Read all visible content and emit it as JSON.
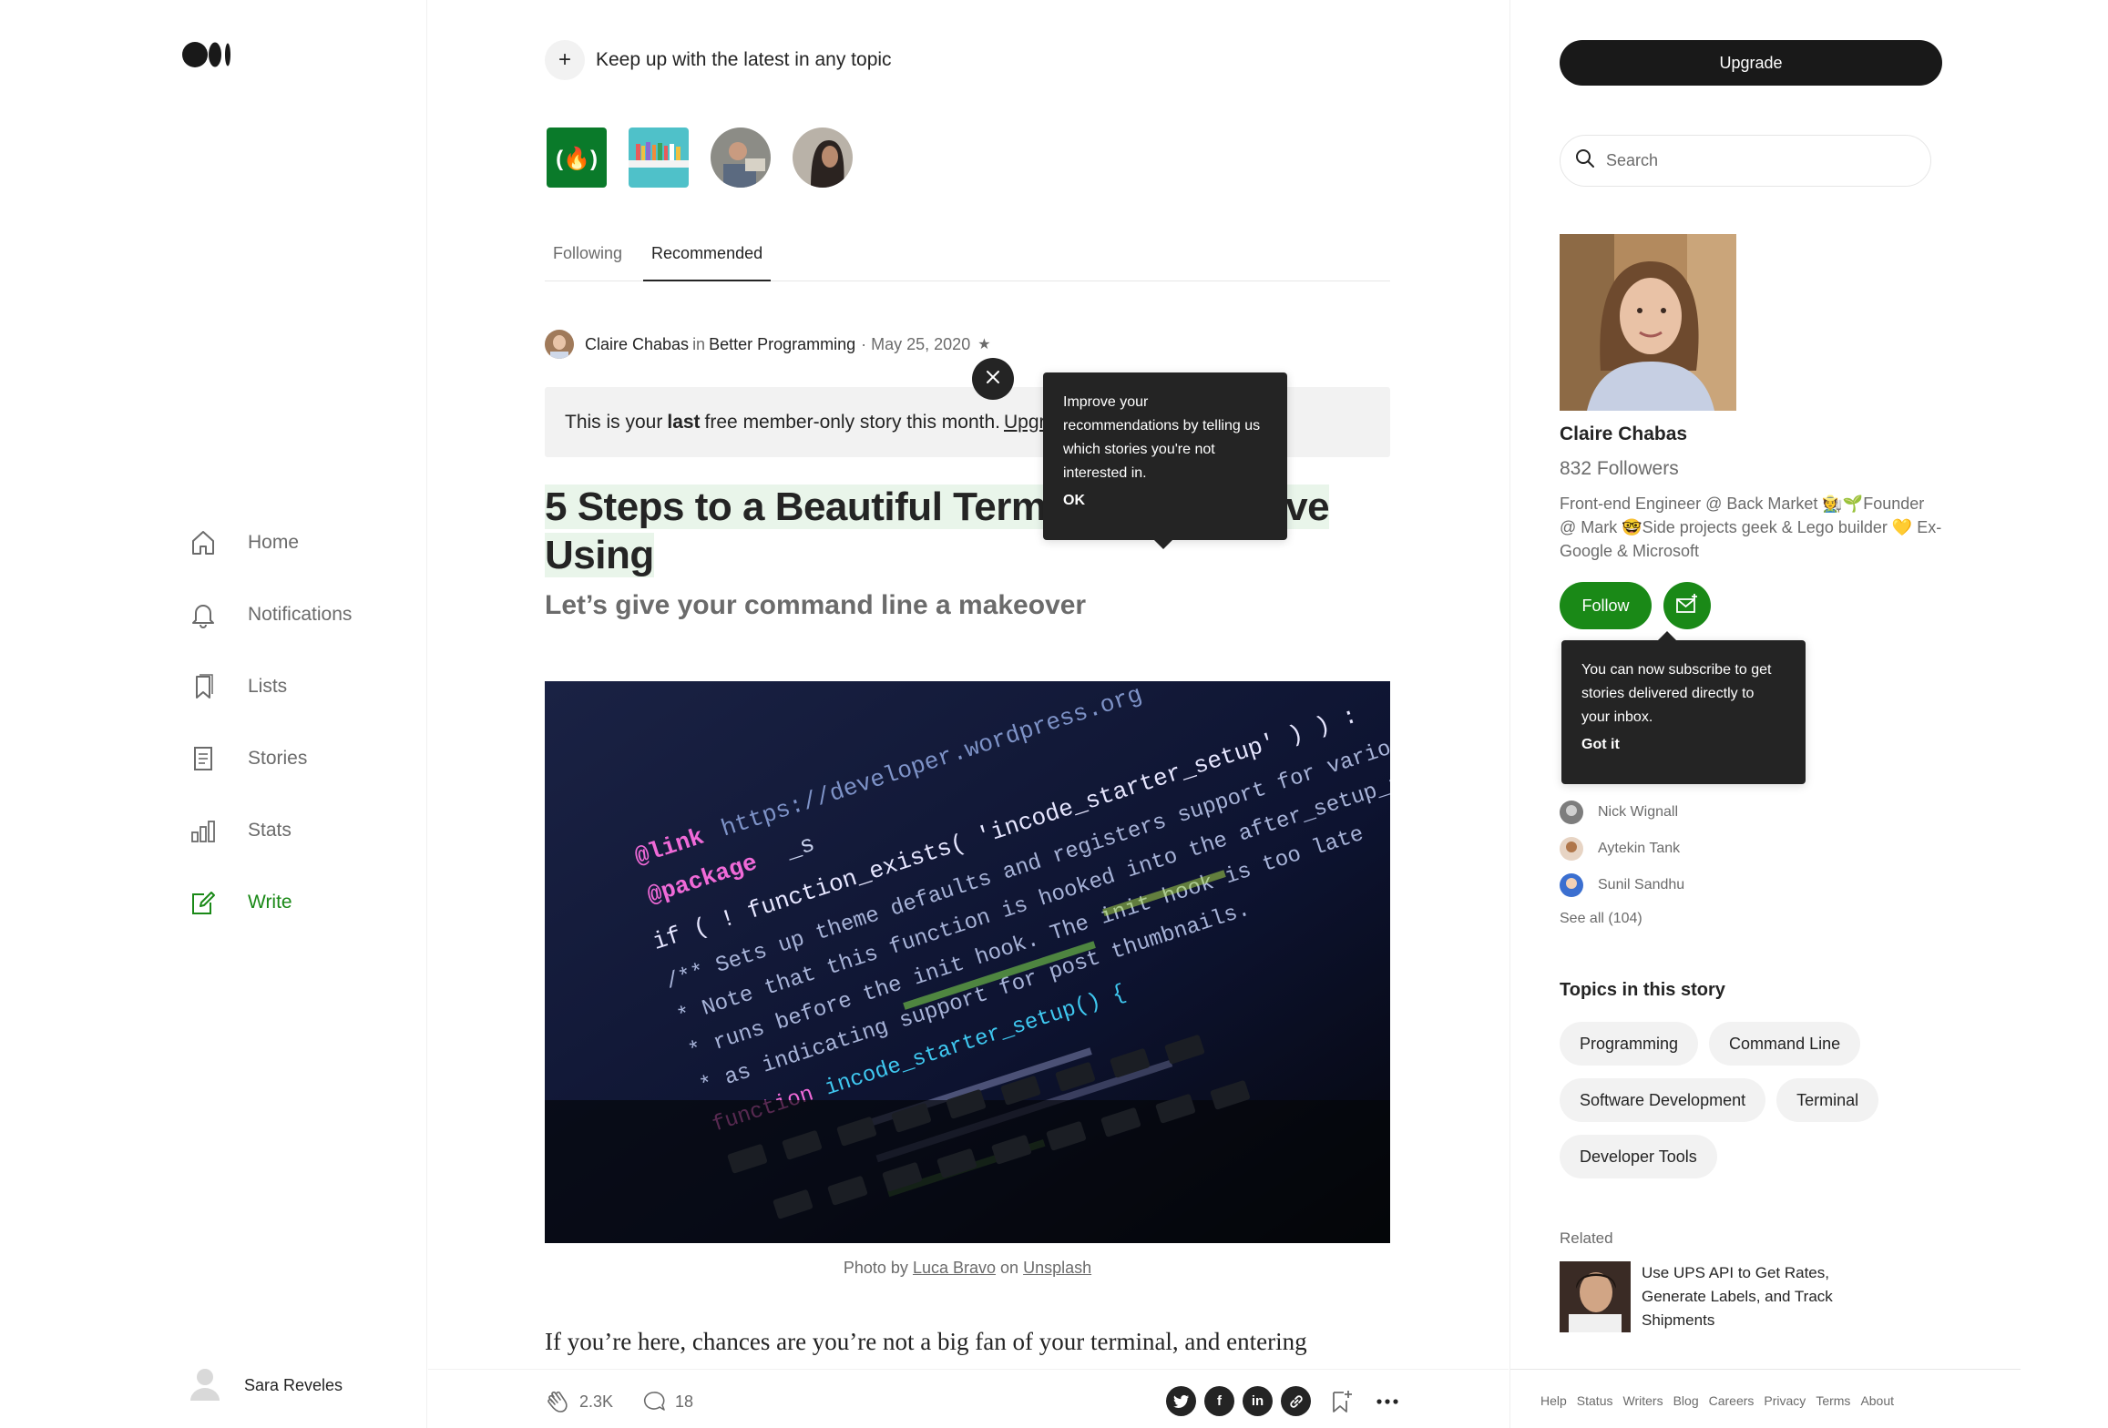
{
  "nav": {
    "items": [
      {
        "label": "Home",
        "icon": "home-icon"
      },
      {
        "label": "Notifications",
        "icon": "bell-icon"
      },
      {
        "label": "Lists",
        "icon": "bookmark-list-icon"
      },
      {
        "label": "Stories",
        "icon": "document-icon"
      },
      {
        "label": "Stats",
        "icon": "bar-chart-icon"
      },
      {
        "label": "Write",
        "icon": "compose-icon"
      }
    ],
    "user_name": "Sara Reveles"
  },
  "feed": {
    "keep_up_text": "Keep up with the latest in any topic",
    "tabs": [
      {
        "label": "Following"
      },
      {
        "label": "Recommended"
      }
    ]
  },
  "article": {
    "author": "Claire Chabas",
    "in_word": "in",
    "publication": "Better Programming",
    "date": "· May 25, 2020",
    "star": "★",
    "paywall_prefix": "This is your",
    "paywall_bold": "last",
    "paywall_suffix": "free member-only story this month.",
    "paywall_link": "Upgrade",
    "title": "5 Steps to a Beautiful Terminal You’ll Love Using",
    "subtitle": "Let’s give your command line a makeover",
    "caption_prefix": "Photo by",
    "caption_author": "Luca Bravo",
    "caption_on": "on",
    "caption_site": "Unsplash",
    "body_first_line": "If you’re here, chances are you’re not a big fan of your terminal, and entering",
    "claps": "2.3K",
    "responses": "18"
  },
  "tooltips": {
    "recommend_text": "Improve your recommendations by telling us which stories you're not interested in.",
    "recommend_action": "OK",
    "subscribe_text": "You can now subscribe to get stories delivered directly to your inbox.",
    "subscribe_action": "Got it"
  },
  "sidebar": {
    "upgrade_label": "Upgrade",
    "search_placeholder": "Search",
    "author_name": "Claire Chabas",
    "followers": "832 Followers",
    "bio": "Front-end Engineer @ Back Market 🧑‍🌾🌱Founder @ Mark 🤓Side projects geek & Lego builder 💛 Ex-Google & Microsoft",
    "follow_label": "Follow",
    "following": [
      {
        "name": "Nick Wignall"
      },
      {
        "name": "Aytekin Tank"
      },
      {
        "name": "Sunil Sandhu"
      }
    ],
    "see_all": "See all (104)",
    "topics_heading": "Topics in this story",
    "topics": [
      "Programming",
      "Command Line",
      "Software Development",
      "Terminal",
      "Developer Tools"
    ],
    "related_heading": "Related",
    "related_title": "Use UPS API to Get Rates, Generate Labels, and Track Shipments",
    "footer_links": [
      "Help",
      "Status",
      "Writers",
      "Blog",
      "Careers",
      "Privacy",
      "Terms",
      "About"
    ]
  },
  "colors": {
    "accent_green": "#1a8917",
    "text_primary": "#242424",
    "text_muted": "#6b6b6b",
    "pill_bg": "#f2f2f2",
    "highlight": "#e9f5ea"
  }
}
